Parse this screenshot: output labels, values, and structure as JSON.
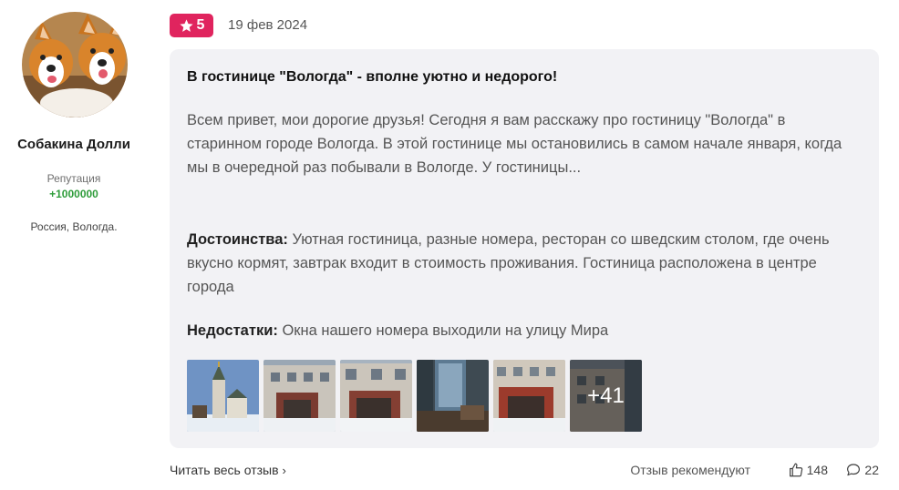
{
  "author": {
    "name": "Собакина Долли",
    "reputation_label": "Репутация",
    "reputation_value": "+1000000",
    "location": "Россия, Вологда."
  },
  "review": {
    "rating": "5",
    "date": "19 фев 2024",
    "title": "В гостинице \"Вологда\" - вполне уютно и недорого!",
    "body": "Всем привет, мои дорогие друзья! Сегодня я вам расскажу про гостиницу \"Вологда\" в старинном городе Вологда. В этой гостинице мы остановились в самом начале января, когда мы в очередной раз побывали в Вологде. У гостиницы...",
    "pros_label": "Достоинства:",
    "pros_text": "Уютная гостиница, разные номера, ресторан со шведским столом, где очень вкусно кормят, завтрак входит в стоимость проживания. Гостиница расположена в центре города",
    "cons_label": "Недостатки:",
    "cons_text": "Окна нашего номера выходили на улицу Мира",
    "more_photos": "+41"
  },
  "footer": {
    "read_all": "Читать весь отзыв",
    "recommend": "Отзыв рекомендуют",
    "likes": "148",
    "comments": "22"
  },
  "colors": {
    "badge": "#e0245e",
    "reputation": "#2e9c3a",
    "card_bg": "#f2f2f5"
  }
}
